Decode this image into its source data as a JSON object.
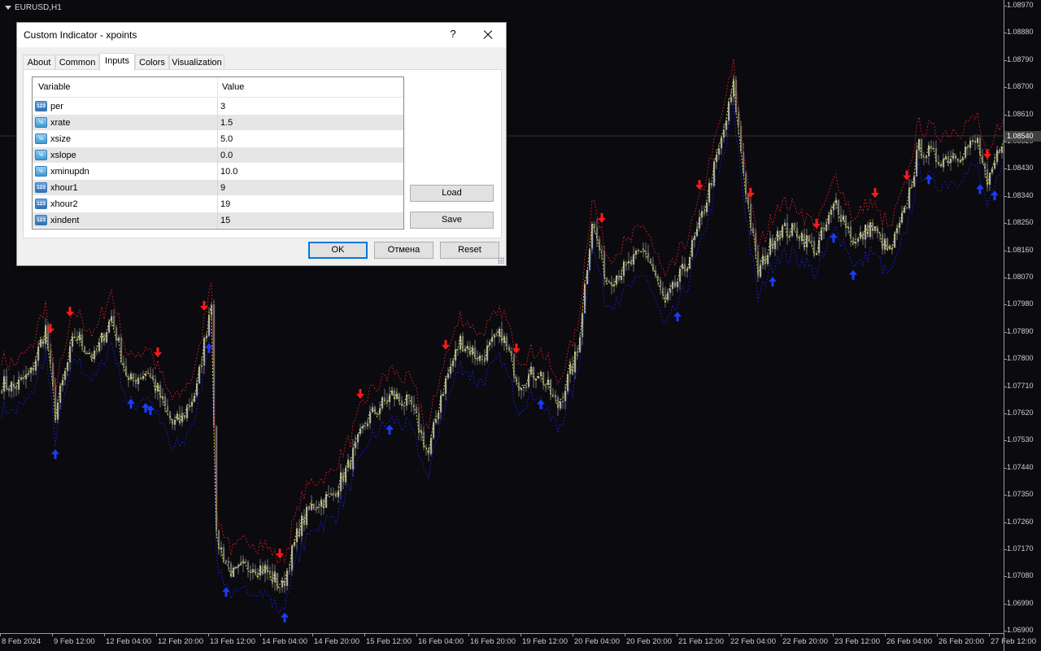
{
  "chart": {
    "symbol": "EURUSD,H1",
    "current_price": "1.08540",
    "colors": {
      "background": "#0a0a0f",
      "candle": "#8c8c8c",
      "upper_band": "#e02020",
      "lower_band": "#2020e0",
      "middle_line": "#e8e830",
      "sell_arrow": "#ff1a1a",
      "buy_arrow": "#1a3cff"
    },
    "price_axis": [
      "1.08970",
      "1.08880",
      "1.08790",
      "1.08700",
      "1.08610",
      "1.08520",
      "1.08430",
      "1.08340",
      "1.08250",
      "1.08160",
      "1.08070",
      "1.07980",
      "1.07890",
      "1.07800",
      "1.07710",
      "1.07620",
      "1.07530",
      "1.07440",
      "1.07350",
      "1.07260",
      "1.07170",
      "1.07080",
      "1.06990",
      "1.06900"
    ],
    "time_axis": [
      "8 Feb 2024",
      "9 Feb 12:00",
      "12 Feb 04:00",
      "12 Feb 20:00",
      "13 Feb 12:00",
      "14 Feb 04:00",
      "14 Feb 20:00",
      "15 Feb 12:00",
      "16 Feb 04:00",
      "16 Feb 20:00",
      "19 Feb 12:00",
      "20 Feb 04:00",
      "20 Feb 20:00",
      "21 Feb 12:00",
      "22 Feb 04:00",
      "22 Feb 20:00",
      "23 Feb 12:00",
      "26 Feb 04:00",
      "26 Feb 20:00",
      "27 Feb 12:00"
    ]
  },
  "chart_data": {
    "type": "candlestick",
    "title": "EURUSD,H1",
    "ylim": [
      1.069,
      1.0897
    ],
    "anchors": [
      [
        0,
        1.0772
      ],
      [
        5,
        1.077
      ],
      [
        12,
        1.0775
      ],
      [
        18,
        1.079
      ],
      [
        22,
        1.0762
      ],
      [
        30,
        1.0788
      ],
      [
        38,
        1.078
      ],
      [
        45,
        1.0794
      ],
      [
        52,
        1.0772
      ],
      [
        60,
        1.0776
      ],
      [
        70,
        1.0758
      ],
      [
        74,
        1.076
      ],
      [
        80,
        1.077
      ],
      [
        86,
        1.08
      ],
      [
        88,
        1.072
      ],
      [
        95,
        1.0708
      ],
      [
        102,
        1.0712
      ],
      [
        108,
        1.071
      ],
      [
        115,
        1.0704
      ],
      [
        122,
        1.0724
      ],
      [
        128,
        1.0732
      ],
      [
        135,
        1.0734
      ],
      [
        142,
        1.0744
      ],
      [
        150,
        1.076
      ],
      [
        160,
        1.0768
      ],
      [
        168,
        1.0764
      ],
      [
        175,
        1.0748
      ],
      [
        180,
        1.0768
      ],
      [
        188,
        1.0786
      ],
      [
        196,
        1.078
      ],
      [
        205,
        1.0788
      ],
      [
        212,
        1.0772
      ],
      [
        220,
        1.0776
      ],
      [
        228,
        1.0764
      ],
      [
        236,
        1.0782
      ],
      [
        242,
        1.0826
      ],
      [
        248,
        1.0806
      ],
      [
        256,
        1.081
      ],
      [
        264,
        1.0816
      ],
      [
        272,
        1.0798
      ],
      [
        280,
        1.081
      ],
      [
        286,
        1.0824
      ],
      [
        295,
        1.0852
      ],
      [
        300,
        1.087
      ],
      [
        304,
        1.0842
      ],
      [
        310,
        1.0808
      ],
      [
        318,
        1.0823
      ],
      [
        326,
        1.0822
      ],
      [
        334,
        1.0816
      ],
      [
        342,
        1.0832
      ],
      [
        350,
        1.0818
      ],
      [
        356,
        1.0824
      ],
      [
        364,
        1.0815
      ],
      [
        370,
        1.0828
      ],
      [
        376,
        1.085
      ],
      [
        384,
        1.0846
      ],
      [
        392,
        1.0848
      ],
      [
        400,
        1.0852
      ],
      [
        404,
        1.0836
      ],
      [
        410,
        1.0853
      ],
      [
        414,
        1.085
      ]
    ],
    "sell_signals": [
      20,
      28,
      64,
      83,
      114,
      147,
      182,
      211,
      246,
      286,
      307,
      334,
      358,
      371,
      404
    ],
    "buy_signals": [
      22,
      53,
      59,
      61,
      85,
      92,
      116,
      159,
      221,
      277,
      316,
      341,
      349,
      380,
      401,
      407
    ]
  },
  "dialog": {
    "title": "Custom Indicator - xpoints",
    "help": "?",
    "tabs": [
      "About",
      "Common",
      "Inputs",
      "Colors",
      "Visualization"
    ],
    "active_tab": "Inputs",
    "grid": {
      "headers": {
        "variable": "Variable",
        "value": "Value"
      },
      "rows": [
        {
          "type": "123",
          "name": "per",
          "value": "3"
        },
        {
          "type": "½",
          "name": "xrate",
          "value": "1.5"
        },
        {
          "type": "½",
          "name": "xsize",
          "value": "5.0"
        },
        {
          "type": "½",
          "name": "xslope",
          "value": "0.0"
        },
        {
          "type": "½",
          "name": "xminupdn",
          "value": "10.0"
        },
        {
          "type": "123",
          "name": "xhour1",
          "value": "9"
        },
        {
          "type": "123",
          "name": "xhour2",
          "value": "19"
        },
        {
          "type": "123",
          "name": "xindent",
          "value": "15"
        }
      ]
    },
    "buttons": {
      "load": "Load",
      "save": "Save",
      "ok": "OK",
      "cancel": "Отмена",
      "reset": "Reset"
    }
  }
}
